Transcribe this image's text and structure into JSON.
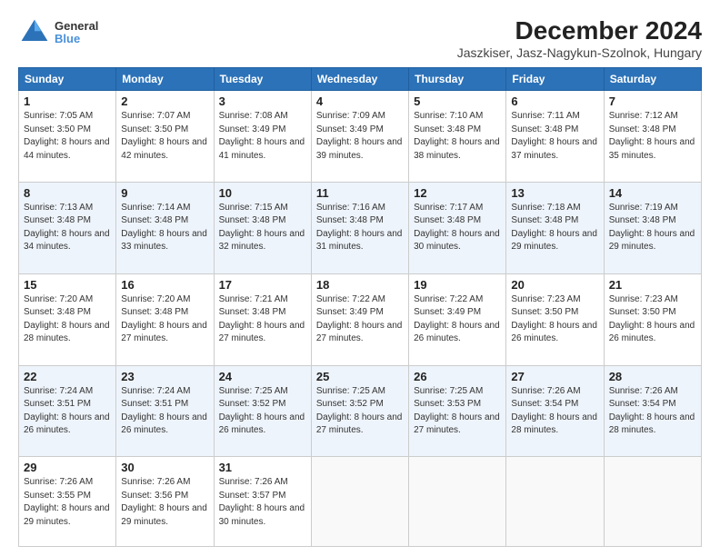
{
  "header": {
    "logo_line1": "General",
    "logo_line2": "Blue",
    "title": "December 2024",
    "subtitle": "Jaszkiser, Jasz-Nagykun-Szolnok, Hungary"
  },
  "weekdays": [
    "Sunday",
    "Monday",
    "Tuesday",
    "Wednesday",
    "Thursday",
    "Friday",
    "Saturday"
  ],
  "weeks": [
    [
      {
        "day": "1",
        "sunrise": "7:05 AM",
        "sunset": "3:50 PM",
        "daylight": "8 hours and 44 minutes."
      },
      {
        "day": "2",
        "sunrise": "7:07 AM",
        "sunset": "3:50 PM",
        "daylight": "8 hours and 42 minutes."
      },
      {
        "day": "3",
        "sunrise": "7:08 AM",
        "sunset": "3:49 PM",
        "daylight": "8 hours and 41 minutes."
      },
      {
        "day": "4",
        "sunrise": "7:09 AM",
        "sunset": "3:49 PM",
        "daylight": "8 hours and 39 minutes."
      },
      {
        "day": "5",
        "sunrise": "7:10 AM",
        "sunset": "3:48 PM",
        "daylight": "8 hours and 38 minutes."
      },
      {
        "day": "6",
        "sunrise": "7:11 AM",
        "sunset": "3:48 PM",
        "daylight": "8 hours and 37 minutes."
      },
      {
        "day": "7",
        "sunrise": "7:12 AM",
        "sunset": "3:48 PM",
        "daylight": "8 hours and 35 minutes."
      }
    ],
    [
      {
        "day": "8",
        "sunrise": "7:13 AM",
        "sunset": "3:48 PM",
        "daylight": "8 hours and 34 minutes."
      },
      {
        "day": "9",
        "sunrise": "7:14 AM",
        "sunset": "3:48 PM",
        "daylight": "8 hours and 33 minutes."
      },
      {
        "day": "10",
        "sunrise": "7:15 AM",
        "sunset": "3:48 PM",
        "daylight": "8 hours and 32 minutes."
      },
      {
        "day": "11",
        "sunrise": "7:16 AM",
        "sunset": "3:48 PM",
        "daylight": "8 hours and 31 minutes."
      },
      {
        "day": "12",
        "sunrise": "7:17 AM",
        "sunset": "3:48 PM",
        "daylight": "8 hours and 30 minutes."
      },
      {
        "day": "13",
        "sunrise": "7:18 AM",
        "sunset": "3:48 PM",
        "daylight": "8 hours and 29 minutes."
      },
      {
        "day": "14",
        "sunrise": "7:19 AM",
        "sunset": "3:48 PM",
        "daylight": "8 hours and 29 minutes."
      }
    ],
    [
      {
        "day": "15",
        "sunrise": "7:20 AM",
        "sunset": "3:48 PM",
        "daylight": "8 hours and 28 minutes."
      },
      {
        "day": "16",
        "sunrise": "7:20 AM",
        "sunset": "3:48 PM",
        "daylight": "8 hours and 27 minutes."
      },
      {
        "day": "17",
        "sunrise": "7:21 AM",
        "sunset": "3:48 PM",
        "daylight": "8 hours and 27 minutes."
      },
      {
        "day": "18",
        "sunrise": "7:22 AM",
        "sunset": "3:49 PM",
        "daylight": "8 hours and 27 minutes."
      },
      {
        "day": "19",
        "sunrise": "7:22 AM",
        "sunset": "3:49 PM",
        "daylight": "8 hours and 26 minutes."
      },
      {
        "day": "20",
        "sunrise": "7:23 AM",
        "sunset": "3:50 PM",
        "daylight": "8 hours and 26 minutes."
      },
      {
        "day": "21",
        "sunrise": "7:23 AM",
        "sunset": "3:50 PM",
        "daylight": "8 hours and 26 minutes."
      }
    ],
    [
      {
        "day": "22",
        "sunrise": "7:24 AM",
        "sunset": "3:51 PM",
        "daylight": "8 hours and 26 minutes."
      },
      {
        "day": "23",
        "sunrise": "7:24 AM",
        "sunset": "3:51 PM",
        "daylight": "8 hours and 26 minutes."
      },
      {
        "day": "24",
        "sunrise": "7:25 AM",
        "sunset": "3:52 PM",
        "daylight": "8 hours and 26 minutes."
      },
      {
        "day": "25",
        "sunrise": "7:25 AM",
        "sunset": "3:52 PM",
        "daylight": "8 hours and 27 minutes."
      },
      {
        "day": "26",
        "sunrise": "7:25 AM",
        "sunset": "3:53 PM",
        "daylight": "8 hours and 27 minutes."
      },
      {
        "day": "27",
        "sunrise": "7:26 AM",
        "sunset": "3:54 PM",
        "daylight": "8 hours and 28 minutes."
      },
      {
        "day": "28",
        "sunrise": "7:26 AM",
        "sunset": "3:54 PM",
        "daylight": "8 hours and 28 minutes."
      }
    ],
    [
      {
        "day": "29",
        "sunrise": "7:26 AM",
        "sunset": "3:55 PM",
        "daylight": "8 hours and 29 minutes."
      },
      {
        "day": "30",
        "sunrise": "7:26 AM",
        "sunset": "3:56 PM",
        "daylight": "8 hours and 29 minutes."
      },
      {
        "day": "31",
        "sunrise": "7:26 AM",
        "sunset": "3:57 PM",
        "daylight": "8 hours and 30 minutes."
      },
      null,
      null,
      null,
      null
    ]
  ]
}
